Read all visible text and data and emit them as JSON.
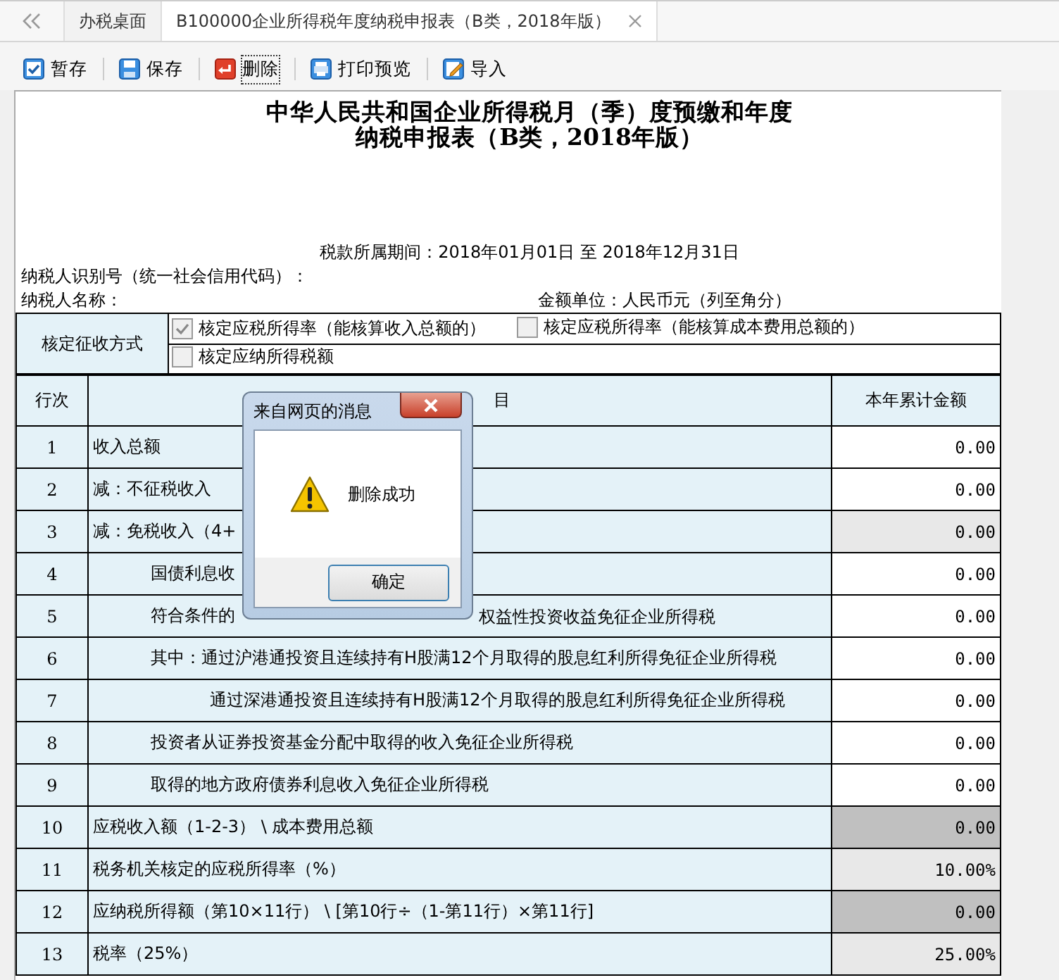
{
  "tabs": [
    {
      "label": "办税桌面",
      "selected": false,
      "closable": false
    },
    {
      "label": "B100000企业所得税年度纳税申报表（B类，2018年版）",
      "selected": true,
      "closable": true
    }
  ],
  "toolbar": [
    {
      "label": "暂存",
      "focused": false
    },
    {
      "label": "保存",
      "focused": false
    },
    {
      "label": "删除",
      "focused": true
    },
    {
      "label": "打印预览",
      "focused": false
    },
    {
      "label": "导入",
      "focused": false
    }
  ],
  "form": {
    "title_lines": [
      "中华人民共和国企业所得税月（季）度预缴和年度",
      "纳税申报表（B类，2018年版）"
    ],
    "period": "税款所属期间：2018年01月01日 至 2018年12月31日",
    "taxpayer_id_label": "纳税人识别号（统一社会信用代码）：",
    "taxpayer_name_label": "纳税人名称：",
    "unit": "金额单位：人民币元（列至角分）"
  },
  "method": {
    "label": "核定征收方式",
    "option_rows": [
      [
        {
          "label": "核定应税所得率（能核算收入总额的）",
          "checked": true
        },
        {
          "label": "核定应税所得率（能核算成本费用总额的）",
          "checked": false
        }
      ],
      [
        {
          "label": "核定应纳所得税额",
          "checked": false
        }
      ]
    ]
  },
  "table": {
    "columns": [
      "行次",
      "目",
      "本年累计金额"
    ],
    "rows": [
      {
        "no": "1",
        "item": "收入总额",
        "value": "0.00",
        "kind": "input"
      },
      {
        "no": "2",
        "item": "减：不征税收入",
        "value": "0.00",
        "kind": "input"
      },
      {
        "no": "3",
        "item": "减：免税收入（4+",
        "value": "0.00",
        "kind": "readonly",
        "children": [
          {
            "no": "4",
            "item": "国债利息收",
            "value": "0.00",
            "kind": "input"
          },
          {
            "no": "5",
            "item": "符合条件的",
            "item_tail": "权益性投资收益免征企业所得税",
            "value": "0.00",
            "kind": "input"
          },
          {
            "no": "6",
            "item": "其中：通过沪港通投资且连续持有H股满12个月取得的股息红利所得免征企业所得税",
            "value": "0.00",
            "kind": "input",
            "children": [
              {
                "no": "7",
                "item": "通过深港通投资且连续持有H股满12个月取得的股息红利所得免征企业所得税",
                "value": "0.00",
                "kind": "input"
              }
            ]
          },
          {
            "no": "8",
            "item": "投资者从证券投资基金分配中取得的收入免征企业所得税",
            "value": "0.00",
            "kind": "input"
          },
          {
            "no": "9",
            "item": "取得的地方政府债券利息收入免征企业所得税",
            "value": "0.00",
            "kind": "input"
          }
        ]
      },
      {
        "no": "10",
        "item": "应税收入额（1-2-3） \\ 成本费用总额",
        "value": "0.00",
        "kind": "computed"
      },
      {
        "no": "11",
        "item": "税务机关核定的应税所得率（%）",
        "value": "10.00%",
        "kind": "readonly"
      },
      {
        "no": "12",
        "item": "应纳税所得额（第10×11行） \\ [第10行÷（1-第11行）×第11行]",
        "value": "0.00",
        "kind": "computed"
      },
      {
        "no": "13",
        "item": "税率（25%）",
        "value": "25.00%",
        "kind": "readonly"
      }
    ]
  },
  "dialog": {
    "title": "来自网页的消息",
    "message": "删除成功",
    "button": "确定"
  }
}
